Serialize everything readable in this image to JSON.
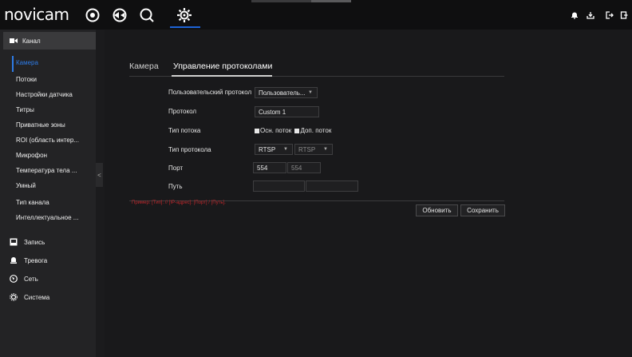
{
  "app": {
    "logo": "novicam"
  },
  "topbar": {
    "icons": [
      "live-view-icon",
      "playback-icon",
      "search-icon",
      "settings-icon"
    ],
    "right_icons": [
      "notification-icon",
      "download-icon",
      "logout-icon",
      "exit-icon"
    ]
  },
  "sidebar": {
    "section_title": "Канал",
    "items": [
      {
        "label": "Камера"
      },
      {
        "label": "Потоки"
      },
      {
        "label": "Настройки датчика"
      },
      {
        "label": "Титры"
      },
      {
        "label": "Приватные зоны"
      },
      {
        "label": "ROI (область интер..."
      },
      {
        "label": "Микрофон"
      },
      {
        "label": "Температура тела ..."
      },
      {
        "label": "Умный"
      },
      {
        "label": "Тип канала"
      },
      {
        "label": "Интеллектуальное ..."
      }
    ],
    "groups": [
      {
        "label": "Запись"
      },
      {
        "label": "Тревога"
      },
      {
        "label": "Сеть"
      },
      {
        "label": "Система"
      }
    ],
    "collapse_label": "<"
  },
  "tabs": [
    {
      "label": "Камера"
    },
    {
      "label": "Управление протоколами"
    }
  ],
  "form": {
    "custom_protocol": {
      "label": "Пользовательский протокол",
      "value": "Пользователь..."
    },
    "protocol": {
      "label": "Протокол",
      "value": "Custom 1"
    },
    "stream_type": {
      "label": "Тип потока",
      "main": "Осн. поток",
      "sub": "Доп. поток"
    },
    "protocol_type": {
      "label": "Тип протокола",
      "value1": "RTSP",
      "value2": "RTSP"
    },
    "port": {
      "label": "Порт",
      "value1": "554",
      "value2": "554"
    },
    "path": {
      "label": "Путь",
      "value1": "",
      "value2": ""
    }
  },
  "hint": "Пример: [Тип]: // [IP-адрес]: [Порт] / [Путь].",
  "buttons": {
    "refresh": "Обновить",
    "save": "Сохранить"
  },
  "colors": {
    "accent": "#2e7be6",
    "hint": "#c0282c",
    "underline": "#1e63d6"
  }
}
